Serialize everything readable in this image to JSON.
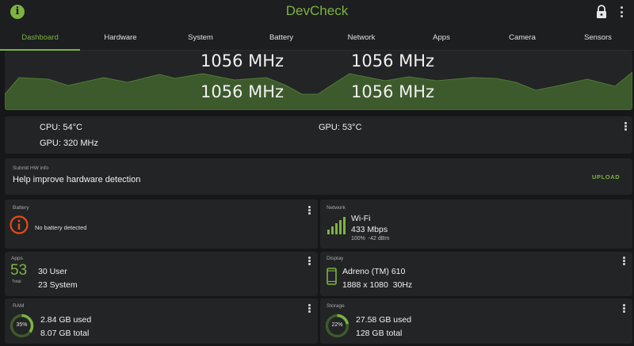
{
  "app": {
    "title": "DevCheck"
  },
  "icons": {
    "info": "info-icon",
    "lock": "lock-icon",
    "more": "more-vert-icon",
    "battery": "battery-info-icon",
    "wifi": "wifi-signal-icon",
    "phone": "phone-icon"
  },
  "tabs": [
    {
      "label": "Dashboard",
      "active": true
    },
    {
      "label": "Hardware"
    },
    {
      "label": "System"
    },
    {
      "label": "Battery"
    },
    {
      "label": "Network"
    },
    {
      "label": "Apps"
    },
    {
      "label": "Camera"
    },
    {
      "label": "Sensors"
    }
  ],
  "cpu_freq": {
    "core1": "1056 MHz",
    "core2": "1056 MHz",
    "core3": "1056 MHz",
    "core4": "1056 MHz"
  },
  "temps": {
    "cpu": "CPU: 54°C",
    "gpu_temp": "GPU: 53°C",
    "gpu_freq": "GPU: 320 MHz"
  },
  "hw_info": {
    "label": "Submit HW info",
    "text": "Help improve hardware detection",
    "action": "UPLOAD"
  },
  "battery": {
    "label": "Battery",
    "status": "No battery detected"
  },
  "network": {
    "label": "Network",
    "type": "Wi-Fi",
    "speed": "433 Mbps",
    "signal_percent": "100%",
    "signal_dbm": "-42 dBm"
  },
  "apps": {
    "label": "Apps",
    "total": "53",
    "total_label": "Total",
    "user": "30 User",
    "system": "23 System"
  },
  "display": {
    "label": "Display",
    "gpu": "Adreno (TM) 610",
    "resolution": "1888 x 1080",
    "refresh": "30Hz"
  },
  "ram": {
    "label": "RAM",
    "percent": "35%",
    "percent_value": 0.35,
    "used": "2.84 GB used",
    "total": "8.07 GB total"
  },
  "storage": {
    "label": "Storage",
    "percent": "22%",
    "percent_value": 0.22,
    "used": "27.58 GB used",
    "total": "128 GB total"
  },
  "colors": {
    "accent": "#7cb342",
    "battery_warning": "#e64a19",
    "background": "#161718",
    "card": "#232425",
    "graph_fill": "#3d5a2c"
  }
}
